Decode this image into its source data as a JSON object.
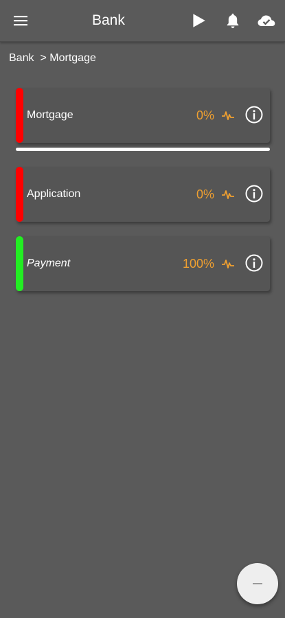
{
  "app_bar": {
    "title": "Bank",
    "icons": [
      "menu-icon",
      "play-icon",
      "bell-icon",
      "cloud-check-icon"
    ]
  },
  "breadcrumb": {
    "root": "Bank",
    "separator": ">",
    "current": "Mortgage"
  },
  "colors": {
    "background": "#5a5a5a",
    "card": "#555555",
    "status_red": "#ff0000",
    "status_green": "#22ee22",
    "percent": "#f0a030"
  },
  "items": [
    {
      "label": "Mortgage",
      "percent": "0%",
      "status": "red",
      "icons": [
        "pulse-icon",
        "info-icon"
      ]
    },
    {
      "label": "Application",
      "percent": "0%",
      "status": "red",
      "icons": [
        "pulse-icon",
        "info-icon"
      ]
    },
    {
      "label": "Payment",
      "percent": "100%",
      "status": "green",
      "italic": true,
      "icons": [
        "pulse-icon",
        "info-icon"
      ]
    }
  ],
  "fab": {
    "icon": "minus-icon"
  }
}
